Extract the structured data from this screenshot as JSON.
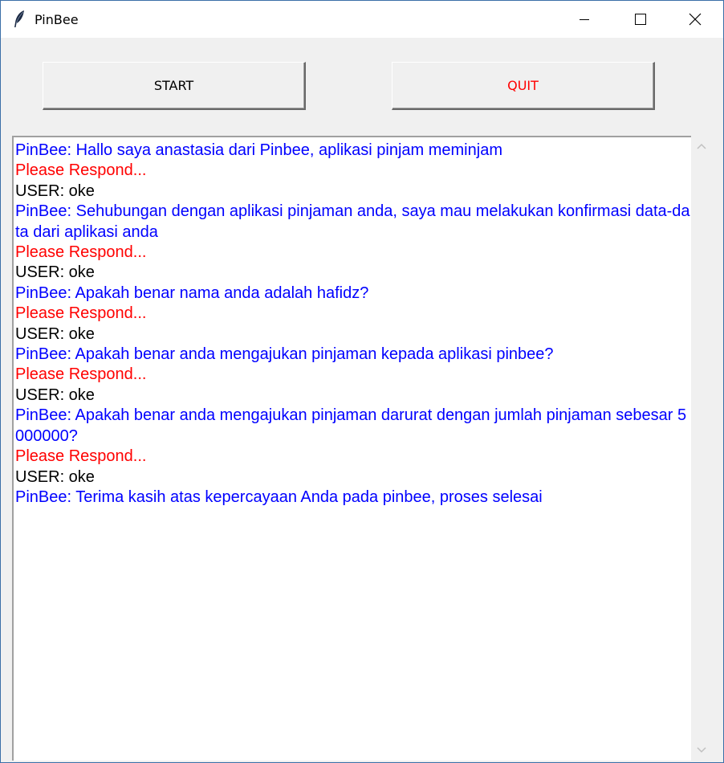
{
  "window": {
    "title": "PinBee",
    "icon": "feather-icon"
  },
  "buttons": {
    "start_label": "START",
    "quit_label": "QUIT"
  },
  "colors": {
    "bot": "#0000ff",
    "prompt": "#ff0000",
    "user": "#000000",
    "quit_text": "#ff0000"
  },
  "chat": {
    "lines": [
      {
        "type": "bot",
        "text": "PinBee: Hallo saya anastasia dari Pinbee, aplikasi pinjam meminjam"
      },
      {
        "type": "prompt",
        "text": "Please Respond..."
      },
      {
        "type": "user",
        "text": "USER: oke"
      },
      {
        "type": "bot",
        "text": "PinBee: Sehubungan dengan aplikasi pinjaman anda, saya mau melakukan konfirmasi data-data dari aplikasi anda"
      },
      {
        "type": "prompt",
        "text": "Please Respond..."
      },
      {
        "type": "user",
        "text": "USER: oke"
      },
      {
        "type": "bot",
        "text": "PinBee: Apakah benar nama anda adalah hafidz?"
      },
      {
        "type": "prompt",
        "text": "Please Respond..."
      },
      {
        "type": "user",
        "text": "USER: oke"
      },
      {
        "type": "bot",
        "text": "PinBee: Apakah benar anda mengajukan pinjaman kepada aplikasi pinbee?"
      },
      {
        "type": "prompt",
        "text": "Please Respond..."
      },
      {
        "type": "user",
        "text": "USER: oke"
      },
      {
        "type": "bot",
        "text": "PinBee: Apakah benar anda mengajukan pinjaman darurat dengan jumlah pinjaman sebesar 5000000?"
      },
      {
        "type": "prompt",
        "text": "Please Respond..."
      },
      {
        "type": "user",
        "text": "USER: oke"
      },
      {
        "type": "bot",
        "text": "PinBee: Terima kasih atas kepercayaan Anda pada pinbee, proses selesai"
      }
    ]
  }
}
